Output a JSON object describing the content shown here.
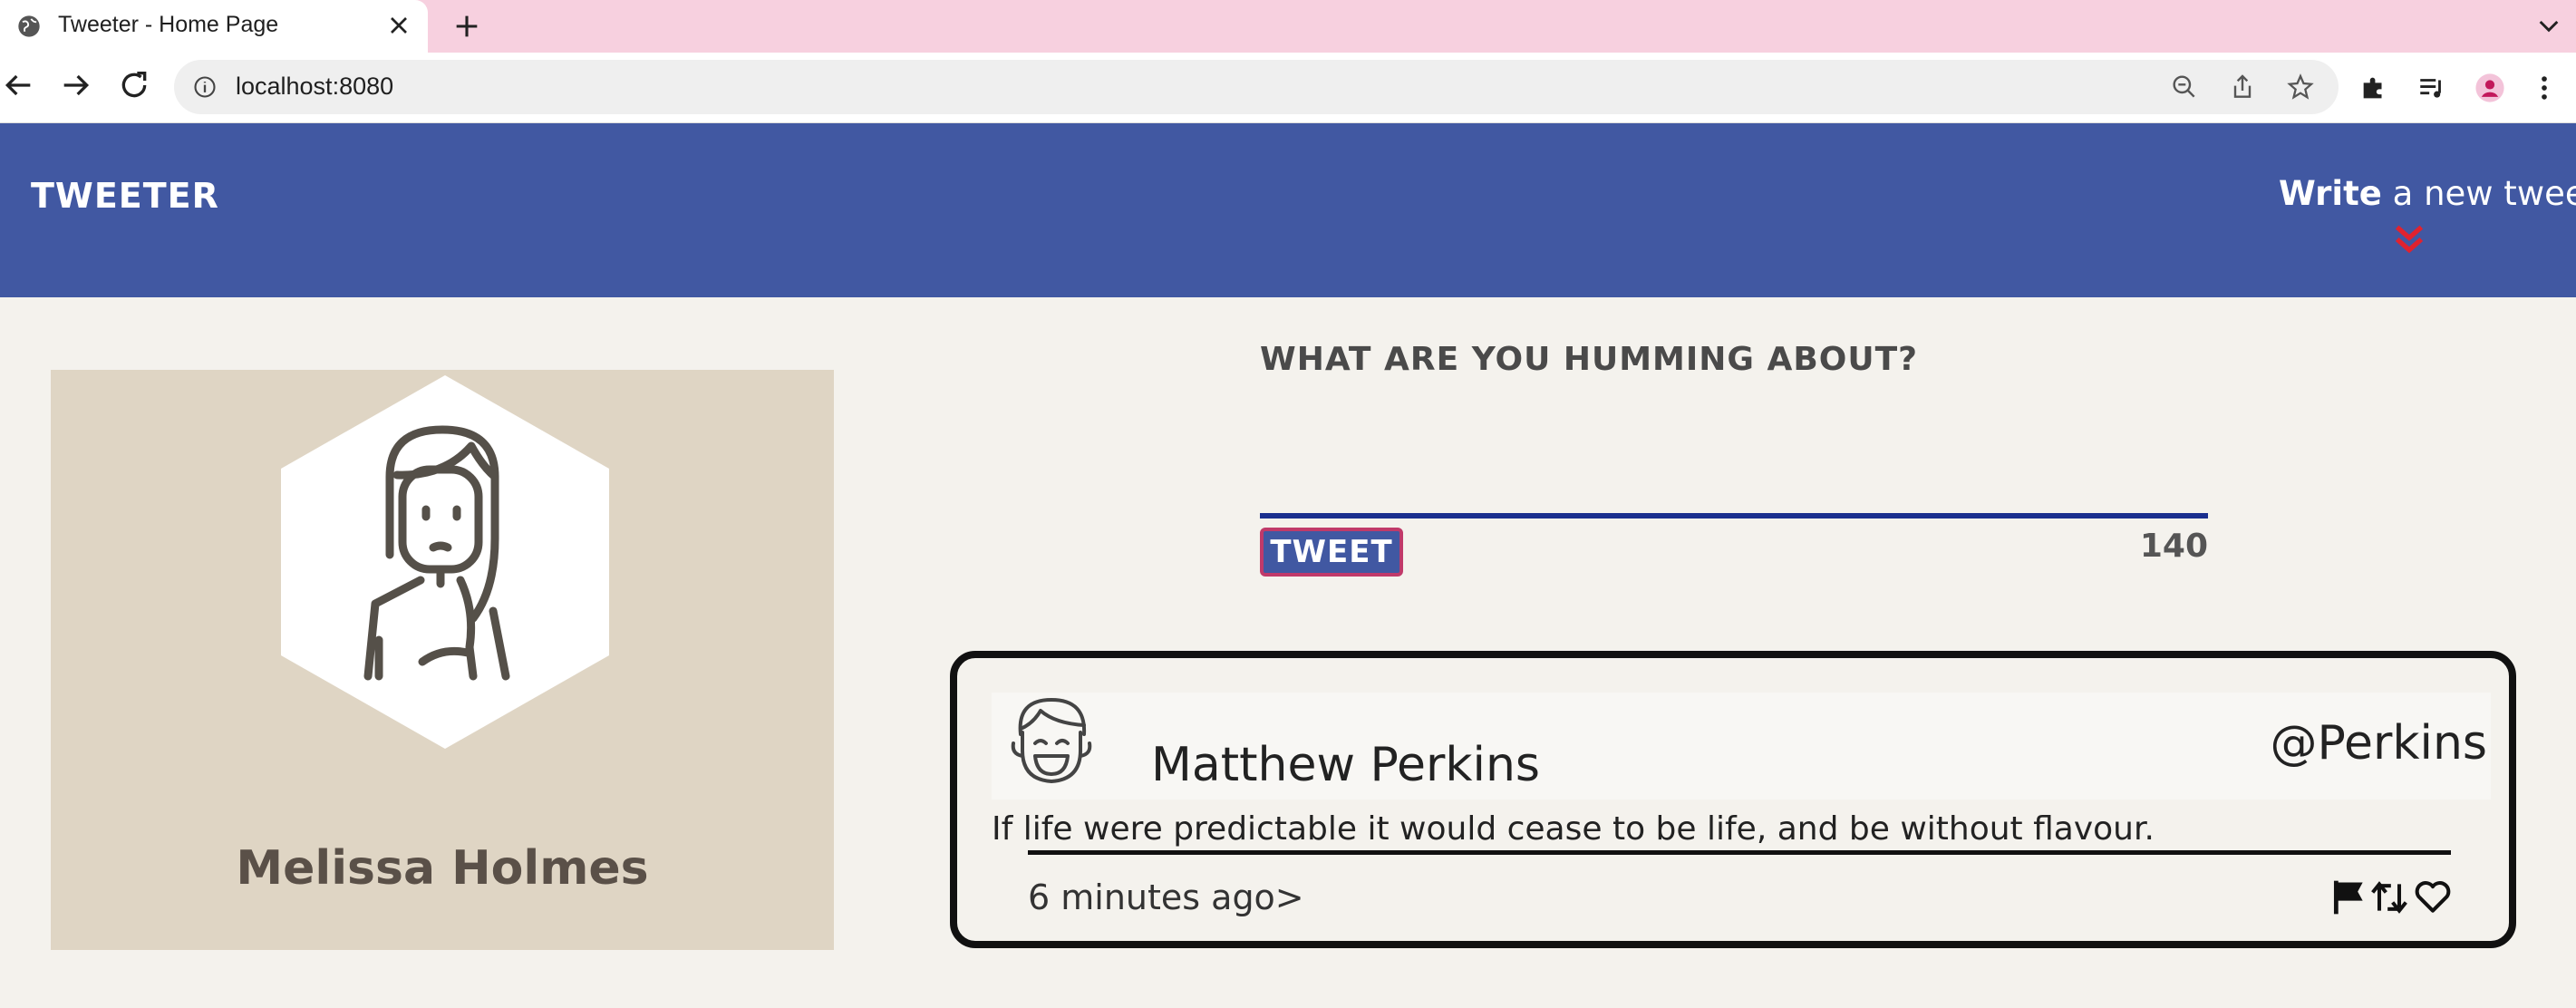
{
  "browser": {
    "tab_title": "Tweeter - Home Page",
    "url": "localhost:8080"
  },
  "header": {
    "logo": "Tweeter",
    "write_bold": "Write",
    "write_rest": " a new tweet"
  },
  "profile": {
    "name": "Melissa Holmes"
  },
  "compose": {
    "title": "What are you humming about?",
    "textarea_value": "",
    "button_label": "Tweet",
    "counter": "140"
  },
  "tweet": {
    "author": "Matthew Perkins",
    "handle": "@Perkins",
    "content": "If life were predictable it would cease to be life, and be without flavour.",
    "time": "6 minutes ago>",
    "actions": [
      "flag-icon",
      "retweet-icon",
      "heart-icon"
    ]
  },
  "colors": {
    "tabbar": "#f7d0df",
    "header": "#4158a2",
    "page_bg": "#f4f2ed",
    "profile_bg": "#dfd5c4",
    "chevron": "#e0222f"
  }
}
